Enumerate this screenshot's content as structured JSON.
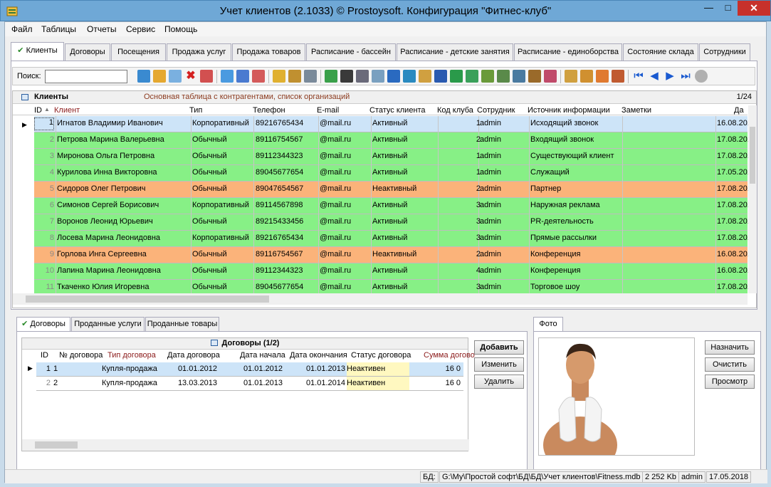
{
  "window": {
    "title": "Учет клиентов (2.1033) © Prostoysoft. Конфигурация \"Фитнес-клуб\"",
    "minimize": "—",
    "maximize": "□",
    "close": "✕"
  },
  "menu": [
    "Файл",
    "Таблицы",
    "Отчеты",
    "Сервис",
    "Помощь"
  ],
  "tabs": [
    "Клиенты",
    "Договоры",
    "Посещения",
    "Продажа услуг",
    "Продажа товаров",
    "Расписание - бассейн",
    "Расписание - детские занятия",
    "Расписание - единоборства",
    "Состояние склада",
    "Сотрудники"
  ],
  "search": {
    "label": "Поиск:",
    "value": ""
  },
  "grid": {
    "title": "Клиенты",
    "description": "Основная таблица с контрагентами, список организаций",
    "count": "1/24",
    "columns": [
      "ID",
      "Клиент",
      "Тип",
      "Телефон",
      "E-mail",
      "Статус клиента",
      "Код клуба",
      "Сотрудник",
      "Источник информации",
      "Заметки",
      "Да"
    ],
    "rows": [
      {
        "id": "1",
        "name": "Игнатов Владимир Иванович",
        "type": "Корпоративный",
        "phone": "89216765434",
        "email": "@mail.ru",
        "status": "Активный",
        "club": "1",
        "employee": "admin",
        "source": "Исходящий звонок",
        "notes": "",
        "date": "16.08.201",
        "color": "#cde4f8"
      },
      {
        "id": "2",
        "name": "Петрова Марина Валерьевна",
        "type": "Обычный",
        "phone": "89116754567",
        "email": "@mail.ru",
        "status": "Активный",
        "club": "2",
        "employee": "admin",
        "source": "Входящий звонок",
        "notes": "",
        "date": "17.08.201",
        "color": "#87f086"
      },
      {
        "id": "3",
        "name": "Миронова Ольга Петровна",
        "type": "Обычный",
        "phone": "89112344323",
        "email": "@mail.ru",
        "status": "Активный",
        "club": "1",
        "employee": "admin",
        "source": "Существующий клиент",
        "notes": "",
        "date": "17.08.201",
        "color": "#87f086"
      },
      {
        "id": "4",
        "name": "Курилова Инна Викторовна",
        "type": "Обычный",
        "phone": "89045677654",
        "email": "@mail.ru",
        "status": "Активный",
        "club": "1",
        "employee": "admin",
        "source": "Служащий",
        "notes": "",
        "date": "17.05.201",
        "color": "#87f086"
      },
      {
        "id": "5",
        "name": "Сидоров Олег Петрович",
        "type": "Обычный",
        "phone": "89047654567",
        "email": "@mail.ru",
        "status": "Неактивный",
        "club": "2",
        "employee": "admin",
        "source": "Партнер",
        "notes": "",
        "date": "17.08.201",
        "color": "#fbb37a"
      },
      {
        "id": "6",
        "name": "Симонов Сергей Борисович",
        "type": "Корпоративный",
        "phone": "89114567898",
        "email": "@mail.ru",
        "status": "Активный",
        "club": "3",
        "employee": "admin",
        "source": "Наружная реклама",
        "notes": "",
        "date": "17.08.201",
        "color": "#87f086"
      },
      {
        "id": "7",
        "name": "Воронов Леонид Юрьевич",
        "type": "Обычный",
        "phone": "89215433456",
        "email": "@mail.ru",
        "status": "Активный",
        "club": "3",
        "employee": "admin",
        "source": "PR-деятельность",
        "notes": "",
        "date": "17.08.201",
        "color": "#87f086"
      },
      {
        "id": "8",
        "name": "Лосева Марина Леонидовна",
        "type": "Корпоративный",
        "phone": "89216765434",
        "email": "@mail.ru",
        "status": "Активный",
        "club": "3",
        "employee": "admin",
        "source": "Прямые рассылки",
        "notes": "",
        "date": "17.08.201",
        "color": "#87f086"
      },
      {
        "id": "9",
        "name": "Горлова Инга Сергеевна",
        "type": "Обычный",
        "phone": "89116754567",
        "email": "@mail.ru",
        "status": "Неактивный",
        "club": "2",
        "employee": "admin",
        "source": "Конференция",
        "notes": "",
        "date": "16.08.201",
        "color": "#fbb37a"
      },
      {
        "id": "10",
        "name": "Лапина Марина Леонидовна",
        "type": "Обычный",
        "phone": "89112344323",
        "email": "@mail.ru",
        "status": "Активный",
        "club": "4",
        "employee": "admin",
        "source": "Конференция",
        "notes": "",
        "date": "16.08.201",
        "color": "#87f086"
      },
      {
        "id": "11",
        "name": "Ткаченко Юлия Игоревна",
        "type": "Обычный",
        "phone": "89045677654",
        "email": "@mail.ru",
        "status": "Активный",
        "club": "3",
        "employee": "admin",
        "source": "Торговое шоу",
        "notes": "",
        "date": "17.08.201",
        "color": "#87f086"
      }
    ]
  },
  "bottom_tabs": [
    "Договоры",
    "Проданные услуги",
    "Проданные товары"
  ],
  "contracts": {
    "title": "Договоры (1/2)",
    "columns": [
      "ID",
      "№ договора",
      "Тип договора",
      "Дата договора",
      "Дата начала",
      "Дата окончания",
      "Статус договора",
      "Сумма догово"
    ],
    "rows": [
      {
        "id": "1",
        "num": "1",
        "type": "Купля-продажа",
        "date": "01.01.2012",
        "start": "01.01.2012",
        "end": "01.01.2013",
        "status": "Неактивен",
        "sum": "16 0"
      },
      {
        "id": "2",
        "num": "2",
        "type": "Купля-продажа",
        "date": "13.03.2013",
        "start": "01.01.2013",
        "end": "01.01.2014",
        "status": "Неактивен",
        "sum": "16 0"
      }
    ]
  },
  "contract_buttons": {
    "add": "Добавить",
    "edit": "Изменить",
    "delete": "Удалить"
  },
  "photo": {
    "tab": "Фото",
    "assign": "Назначить",
    "clear": "Очистить",
    "view": "Просмотр"
  },
  "status": {
    "db_label": "БД:",
    "path": "G:\\My\\Простой софт\\БД\\БД\\Учет клиентов\\Fitness.mdb",
    "size": "2 252 Kb",
    "user": "admin",
    "date": "17.05.2018"
  }
}
